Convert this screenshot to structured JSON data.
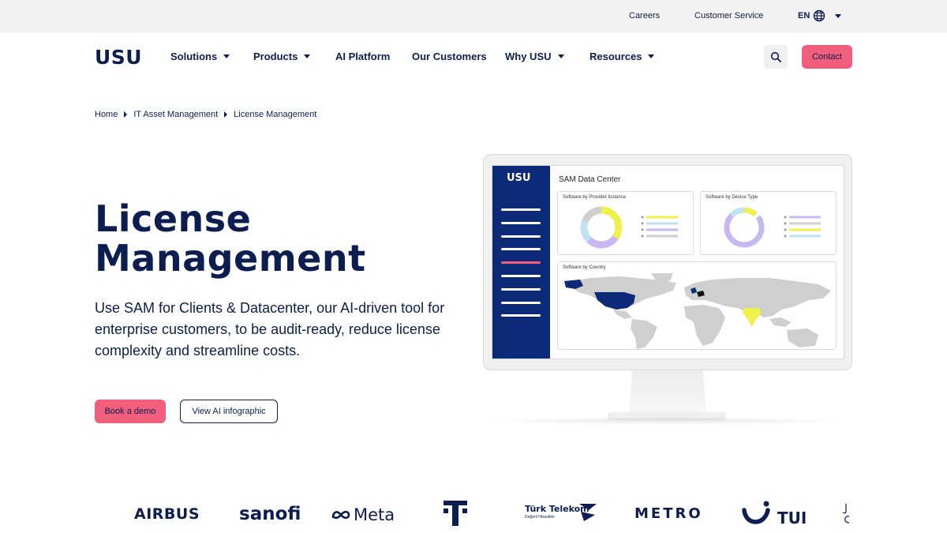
{
  "topbar": {
    "careers": "Careers",
    "customer_service": "Customer Service",
    "language": "EN"
  },
  "nav": {
    "logo": "USU",
    "items": [
      {
        "label": "Solutions"
      },
      {
        "label": "Products"
      },
      {
        "label": "AI Platform"
      },
      {
        "label": "Our Customers"
      },
      {
        "label": "Why USU"
      },
      {
        "label": "Resources"
      }
    ],
    "contact": "Contact"
  },
  "breadcrumb": [
    "Home",
    "IT Asset Management",
    "License Management"
  ],
  "hero": {
    "title_line1": "License",
    "title_line2": "Management",
    "description": "Use SAM for Clients & Datacenter, our AI-driven tool for enterprise customers, to be audit-ready, reduce license complexity and streamline costs.",
    "primary_button": "Book a demo",
    "secondary_button": "View AI infographic"
  },
  "dashboard": {
    "logo": "USU",
    "title": "SAM Data Center",
    "card1_title": "Software by Provider Instance",
    "card2_title": "Software by Device Type",
    "card3_title": "Software by Country"
  },
  "customers": {
    "logos": [
      "AIRBUS",
      "sanofi",
      "Meta",
      "Türk Telekom",
      "METRO",
      "TUI"
    ],
    "turk_sub": "Değerli Hissettirir"
  },
  "colors": {
    "brand_navy": "#0c1e50",
    "accent_pink": "#f25f7c",
    "sidebar_blue": "#0c2a78",
    "chart_yellow": "#eef24a",
    "chart_purple": "#c7b8f2",
    "chart_lightblue": "#bfe3f2",
    "chart_gray": "#cfcfcf"
  }
}
